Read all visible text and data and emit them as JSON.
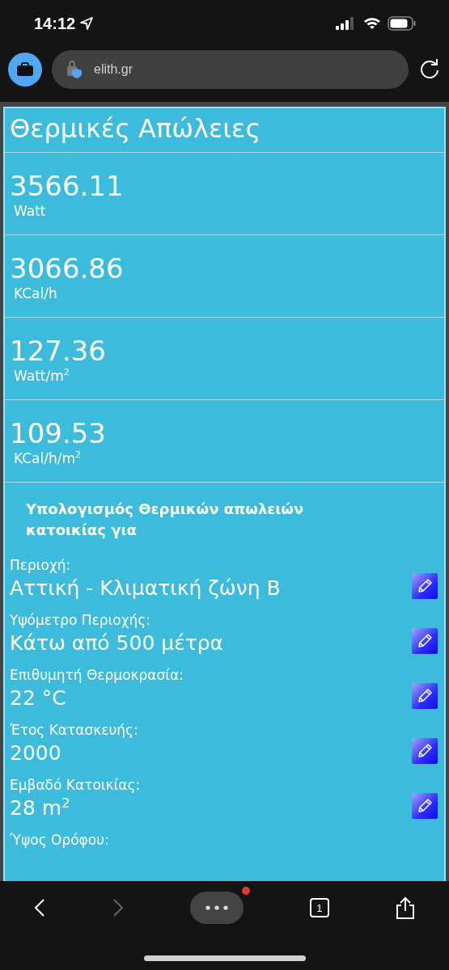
{
  "status_bar": {
    "time": "14:12"
  },
  "address_bar": {
    "url": "elith.gr"
  },
  "page": {
    "title": "Θερμικές Απώλειες",
    "results": [
      {
        "value": "3566.11",
        "unit": "Watt"
      },
      {
        "value": "3066.86",
        "unit": "KCal/h"
      },
      {
        "value": "127.36",
        "unit": "Watt/m$^{2}$"
      },
      {
        "value": "109.53",
        "unit": "KCal/h/m$^{2}$"
      }
    ],
    "subtitle": "Υπολογισμός Θερμικών απωλειών κατοικίας για",
    "fields": [
      {
        "label": "Περιοχή:",
        "value": "Αττική - Κλιματική ζώνη Β"
      },
      {
        "label": "Υψόμετρο Περιοχής:",
        "value": "Κάτω από 500 μέτρα"
      },
      {
        "label": "Επιθυμητή Θερμοκρασία:",
        "value": "22 °C"
      },
      {
        "label": "Έτος Κατασκευής:",
        "value": "2000"
      },
      {
        "label": "Εμβαδό Κατοικίας:",
        "value": "28 m$^{2}$"
      },
      {
        "label": "Ύψος Ορόφου:"
      }
    ]
  },
  "toolbar": {
    "tab_count": "1"
  }
}
